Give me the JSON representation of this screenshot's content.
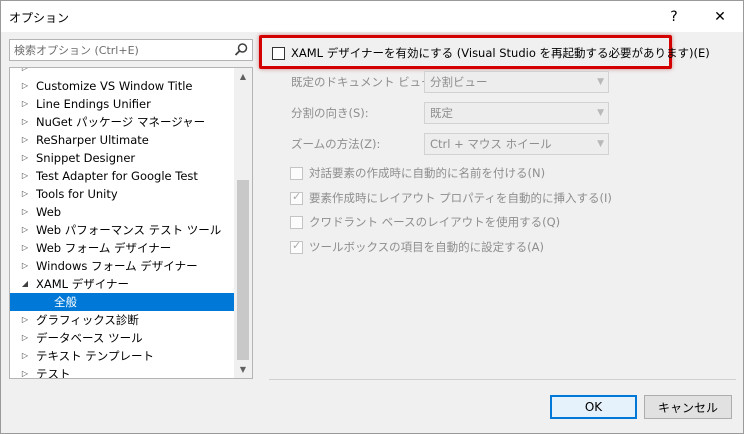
{
  "window": {
    "title": "オプション",
    "help_label": "?",
    "close_label": "✕"
  },
  "search": {
    "placeholder": "検索オプション (Ctrl+E)"
  },
  "tree": {
    "items": [
      {
        "label": "Customize VS Window Title",
        "expanded": false
      },
      {
        "label": "Line Endings Unifier",
        "expanded": false
      },
      {
        "label": "NuGet パッケージ マネージャー",
        "expanded": false
      },
      {
        "label": "ReSharper Ultimate",
        "expanded": false
      },
      {
        "label": "Snippet Designer",
        "expanded": false
      },
      {
        "label": "Test Adapter for Google Test",
        "expanded": false
      },
      {
        "label": "Tools for Unity",
        "expanded": false
      },
      {
        "label": "Web",
        "expanded": false
      },
      {
        "label": "Web パフォーマンス テスト ツール",
        "expanded": false
      },
      {
        "label": "Web フォーム デザイナー",
        "expanded": false
      },
      {
        "label": "Windows フォーム デザイナー",
        "expanded": false
      },
      {
        "label": "XAML デザイナー",
        "expanded": true
      },
      {
        "label": "全般",
        "selected": true
      },
      {
        "label": "グラフィックス診断",
        "expanded": false
      },
      {
        "label": "データベース ツール",
        "expanded": false
      },
      {
        "label": "テキスト テンプレート",
        "expanded": false
      },
      {
        "label": "テスト",
        "expanded": false
      }
    ]
  },
  "main": {
    "enable_designer": {
      "label": "XAML デザイナーを有効にする (Visual Studio を再起動する必要があります)(E)",
      "checked": false
    },
    "fields": [
      {
        "label": "既定のドキュメント ビュー(D):",
        "value": "分割ビュー"
      },
      {
        "label": "分割の向き(S):",
        "value": "既定"
      },
      {
        "label": "ズームの方法(Z):",
        "value": "Ctrl + マウス ホイール"
      }
    ],
    "options": [
      {
        "label": "対話要素の作成時に自動的に名前を付ける(N)",
        "checked": false
      },
      {
        "label": "要素作成時にレイアウト プロパティを自動的に挿入する(I)",
        "checked": true
      },
      {
        "label": "クワドラント ベースのレイアウトを使用する(Q)",
        "checked": false
      },
      {
        "label": "ツールボックスの項目を自動的に設定する(A)",
        "checked": true
      }
    ],
    "highlight_color": "#d40000"
  },
  "buttons": {
    "ok": "OK",
    "cancel": "キャンセル"
  }
}
